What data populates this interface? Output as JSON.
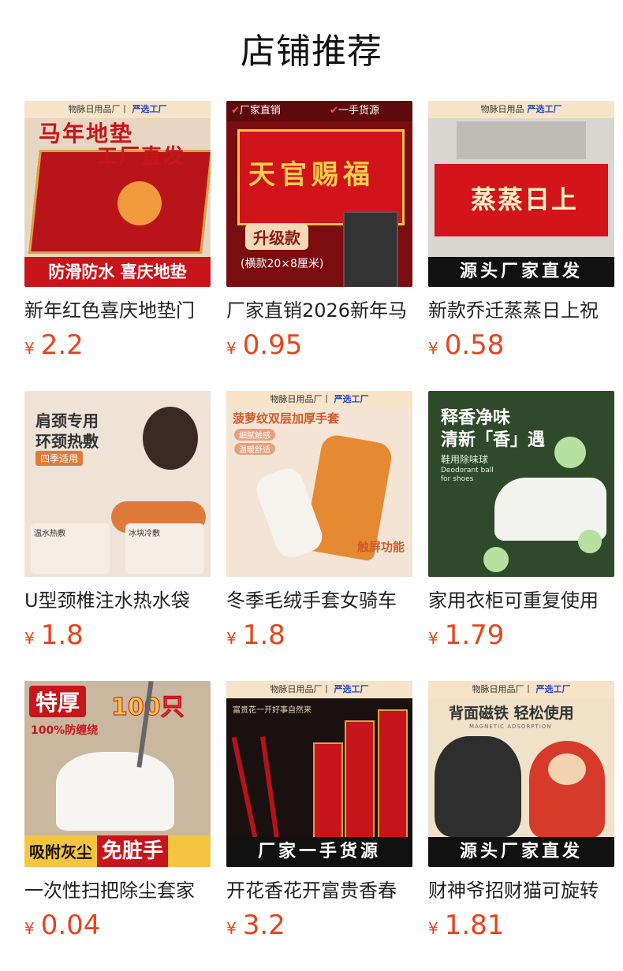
{
  "page": {
    "title": "店铺推荐"
  },
  "products": [
    {
      "name": "新年红色喜庆地垫门",
      "currency": "¥",
      "price": "2.2",
      "thumb": {
        "strip": "物脉日用品厂丨",
        "strip_badge": "严选工厂",
        "headline": "马年地垫",
        "headline2": "工厂直发",
        "bottom": "防滑防水 喜庆地垫"
      }
    },
    {
      "name": "厂家直销2026新年马",
      "currency": "¥",
      "price": "0.95",
      "thumb": {
        "tag_left": "厂家直销",
        "tag_right": "一手货源",
        "headline": "天官赐福",
        "upgrade": "升级款",
        "size_note": "(横款20×8厘米)"
      }
    },
    {
      "name": "新款乔迁蒸蒸日上祝",
      "currency": "¥",
      "price": "0.58",
      "thumb": {
        "strip": "物脉日用品",
        "strip_badge": "严选工厂",
        "headline": "蒸蒸日上",
        "bottom": "源头厂家直发"
      }
    },
    {
      "name": "U型颈椎注水热水袋",
      "currency": "¥",
      "price": "1.8",
      "thumb": {
        "headline": "肩颈专用",
        "headline2": "环颈热敷",
        "badge": "四季适用",
        "label_a": "温水热敷",
        "label_b": "冰块冷敷"
      }
    },
    {
      "name": "冬季毛绒手套女骑车",
      "currency": "¥",
      "price": "1.8",
      "thumb": {
        "strip": "物脉日用品厂丨",
        "strip_badge": "严选工厂",
        "headline": "菠萝纹双层加厚手套",
        "pill_a": "细腻触感",
        "pill_b": "温暖舒适",
        "corner": "触屏功能"
      }
    },
    {
      "name": "家用衣柜可重复使用",
      "currency": "¥",
      "price": "1.79",
      "thumb": {
        "headline": "释香净味",
        "headline2": "清新「香」遇",
        "sub": "鞋用除味球",
        "sub_en": "Deodorant ball for shoes"
      }
    },
    {
      "name": "一次性扫把除尘套家",
      "currency": "¥",
      "price": "0.04",
      "thumb": {
        "tag": "特厚",
        "count": "100只",
        "note": "100%防缠绕",
        "bottom_a": "吸附灰尘",
        "bottom_b": "免脏手"
      }
    },
    {
      "name": "开花香花开富贵香春",
      "currency": "¥",
      "price": "3.2",
      "thumb": {
        "strip": "物脉日用品厂丨",
        "strip_badge": "严选工厂",
        "sub": "富贵花一开好事自然来",
        "bottom": "厂家一手货源"
      }
    },
    {
      "name": "财神爷招财猫可旋转",
      "currency": "¥",
      "price": "1.81",
      "thumb": {
        "strip": "物脉日用品厂丨",
        "strip_badge": "严选工厂",
        "headline": "背面磁铁 轻松使用",
        "sub": "MAGNETIC ADSORPTION",
        "bottom": "源头厂家直发"
      }
    }
  ],
  "colors": {
    "price": "#e8431b",
    "festive_red": "#c8151b",
    "gold": "#f5c542"
  }
}
